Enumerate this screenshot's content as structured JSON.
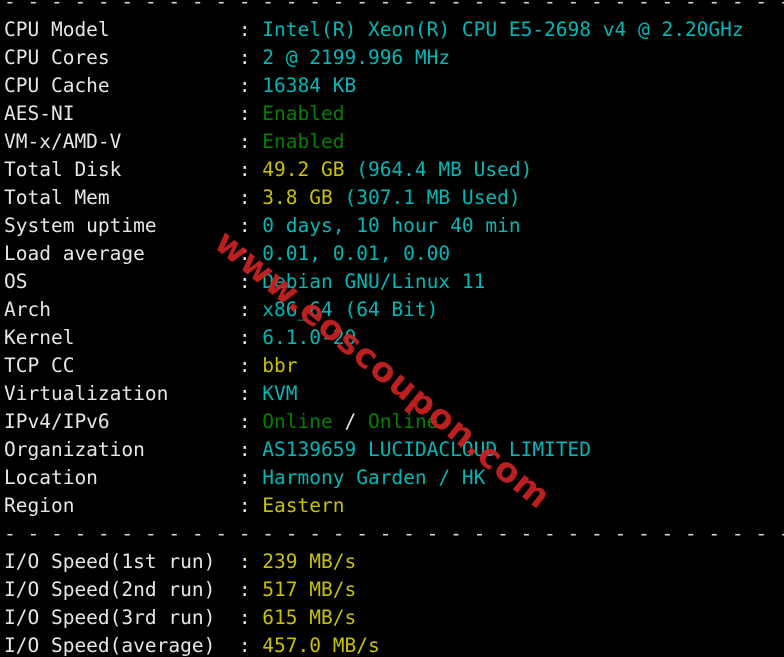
{
  "terminal": {
    "background_color": "#000000",
    "label_color": "#e6e6e6",
    "cyan_color": "#00b7b7",
    "green_color": "#008000",
    "yellow_color": "#c8c000",
    "watermark_color": "#cc2222",
    "separator": "- - - - - - - - - - - - - - - - - - - - - - - - - - - - - - - - - - - - - - - - - - - - - - - - - - - - - - - - - - - - - - - - - - - - - - - -",
    "watermark_text": "www.eoscoupon.com",
    "colon": ":"
  },
  "system_info": [
    {
      "label": "CPU Model",
      "value": "Intel(R) Xeon(R) CPU E5-2698 v4 @ 2.20GHz",
      "color": "cyan"
    },
    {
      "label": "CPU Cores",
      "value": "2 @ 2199.996 MHz",
      "color": "cyan"
    },
    {
      "label": "CPU Cache",
      "value": "16384 KB",
      "color": "cyan"
    },
    {
      "label": "AES-NI",
      "value": "Enabled",
      "color": "green"
    },
    {
      "label": "VM-x/AMD-V",
      "value": "Enabled",
      "color": "green"
    },
    {
      "label": "Total Disk",
      "value": "49.2 GB",
      "value2": " (964.4 MB Used)",
      "color": "yellow",
      "color2": "cyan"
    },
    {
      "label": "Total Mem",
      "value": "3.8 GB",
      "value2": " (307.1 MB Used)",
      "color": "yellow",
      "color2": "cyan"
    },
    {
      "label": "System uptime",
      "value": "0 days, 10 hour 40 min",
      "color": "cyan"
    },
    {
      "label": "Load average",
      "value": "0.01, 0.01, 0.00",
      "color": "cyan"
    },
    {
      "label": "OS",
      "value": "Debian GNU/Linux 11",
      "color": "cyan"
    },
    {
      "label": "Arch",
      "value": "x86_64 (64 Bit)",
      "color": "cyan"
    },
    {
      "label": "Kernel",
      "value": "6.1.0-20",
      "color": "cyan"
    },
    {
      "label": "TCP CC",
      "value": "bbr",
      "color": "yellow"
    },
    {
      "label": "Virtualization",
      "value": "KVM",
      "color": "cyan"
    },
    {
      "label": "IPv4/IPv6",
      "value": "Online",
      "sep": " / ",
      "value2": "Online",
      "color": "green",
      "color2": "green"
    },
    {
      "label": "Organization",
      "value": "AS139659 LUCIDACLOUD LIMITED",
      "color": "cyan"
    },
    {
      "label": "Location",
      "value": "Harmony Garden / HK",
      "color": "cyan"
    },
    {
      "label": "Region",
      "value": "Eastern",
      "color": "yellow"
    }
  ],
  "io_speed": [
    {
      "label": "I/O Speed(1st run)",
      "value": "239 MB/s",
      "color": "yellow"
    },
    {
      "label": "I/O Speed(2nd run)",
      "value": "517 MB/s",
      "color": "yellow"
    },
    {
      "label": "I/O Speed(3rd run)",
      "value": "615 MB/s",
      "color": "yellow"
    },
    {
      "label": "I/O Speed(average)",
      "value": "457.0 MB/s",
      "color": "yellow"
    }
  ]
}
